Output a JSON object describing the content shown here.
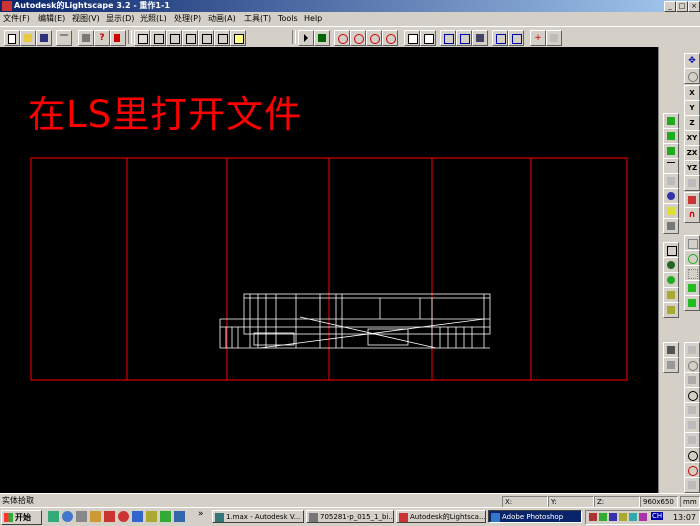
{
  "window": {
    "title": "Autodesk的Lightscape 3.2 - 重作1-1",
    "icon": "app-icon"
  },
  "window_buttons": {
    "minimize": "_",
    "maximize": "□",
    "close": "×"
  },
  "menu": [
    "文件(F)",
    "编辑(E)",
    "视图(V)",
    "显示(D)",
    "光照(L)",
    "处理(P)",
    "动画(A)",
    "工具(T)",
    "Tools",
    "Help"
  ],
  "toolbar_icons": [
    "new-icon",
    "open-icon",
    "save-icon",
    "undo-icon",
    "print-icon",
    "help-icon",
    "context-help-icon",
    "layer-icon",
    "material-icon",
    "luminaire-icon",
    "block-icon",
    "window-icon",
    "light-icon",
    "select-icon",
    "query-icon",
    "zoom-icon",
    "zoom-rect-icon",
    "zoom-out-icon",
    "zoom-all-icon",
    "copy-icon",
    "paste-icon",
    "camera-icon",
    "target-icon",
    "animate-icon",
    "render-icon",
    "move-icon",
    "rotate-icon"
  ],
  "viewport": {
    "caption": "在LS里打开文件",
    "background": "#000000",
    "frame_color": "#ff0000",
    "model_color": "#ffffff"
  },
  "right_toolbar": {
    "x": "X",
    "y": "Y",
    "z": "Z",
    "xy": "XY",
    "zx": "ZX",
    "yz": "YZ"
  },
  "status": {
    "text": "实体拾取",
    "x_label": "X:",
    "y_label": "Y:",
    "z_label": "Z:",
    "resolution": "960x650",
    "unit": "mm"
  },
  "taskbar": {
    "start": "开始",
    "more": "»",
    "tasks": [
      {
        "label": "1.max - Autodesk V...",
        "active": false
      },
      {
        "label": "705281-p_015_1_bi...",
        "active": false
      },
      {
        "label": "Autodesk的Lightsca...",
        "active": false
      },
      {
        "label": "Adobe Photoshop",
        "active": true
      }
    ],
    "tray_lang": "CH",
    "clock": "13:07"
  },
  "colors": {
    "titlebar": "#0a246a",
    "accent_red": "#ff0000"
  }
}
